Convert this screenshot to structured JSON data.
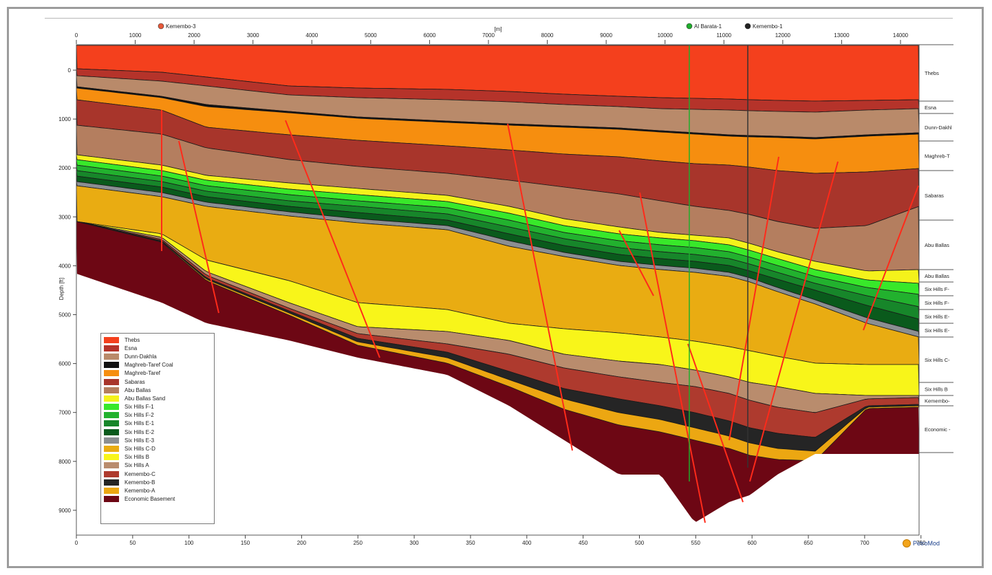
{
  "top_axis": {
    "unit": "[m]",
    "ticks": [
      "0",
      "1000",
      "2000",
      "3000",
      "4000",
      "5000",
      "6000",
      "7000",
      "8000",
      "9000",
      "10000",
      "11000",
      "12000",
      "13000",
      "14000"
    ]
  },
  "bottom_axis": {
    "ticks": [
      "0",
      "50",
      "100",
      "150",
      "200",
      "250",
      "300",
      "350",
      "400",
      "450",
      "500",
      "550",
      "600",
      "650",
      "700",
      "750"
    ]
  },
  "left_axis": {
    "label": "Depth [ft]",
    "ticks": [
      "0",
      "1000",
      "2000",
      "3000",
      "4000",
      "5000",
      "6000",
      "7000",
      "8000",
      "9000"
    ]
  },
  "wells": [
    {
      "name": "Kemembo-3",
      "color": "#e8593a"
    },
    {
      "name": "Al Barata-1",
      "color": "#1fae2c"
    },
    {
      "name": "Kemembo-1",
      "color": "#222222"
    }
  ],
  "right_labels": [
    "Thebs",
    "Esna",
    "Dunn-Dakhl",
    "Maghreb-T",
    "Sabaras",
    "Abu Ballas",
    "Abu Ballas",
    "Six Hills F-",
    "Six Hills F-",
    "Six Hills E-",
    "Six Hills E-",
    "Six Hills C-",
    "Six Hills B",
    "Kemembo-",
    "Economic -"
  ],
  "legend": [
    {
      "label": "Thebs",
      "color": "#f4401d"
    },
    {
      "label": "Esna",
      "color": "#b5332a"
    },
    {
      "label": "Dunn-Dakhla",
      "color": "#b98a6a"
    },
    {
      "label": "Maghreb-Taref Coal",
      "color": "#111111"
    },
    {
      "label": "Maghreb-Taref",
      "color": "#f68e0f"
    },
    {
      "label": "Sabaras",
      "color": "#a8352b"
    },
    {
      "label": "Abu Ballas",
      "color": "#b47e5f"
    },
    {
      "label": "Abu Ballas Sand",
      "color": "#f4f21b"
    },
    {
      "label": "Six Hills F-1",
      "color": "#38e82a"
    },
    {
      "label": "Six Hills F-2",
      "color": "#22b12e"
    },
    {
      "label": "Six Hills E-1",
      "color": "#17862a"
    },
    {
      "label": "Six Hills E-2",
      "color": "#0a5a1c"
    },
    {
      "label": "Six Hills E-3",
      "color": "#8b8f92"
    },
    {
      "label": "Six Hills C-D",
      "color": "#e9ac12"
    },
    {
      "label": "Six Hills B",
      "color": "#f8f51a"
    },
    {
      "label": "Six Hills A",
      "color": "#b98c6d"
    },
    {
      "label": "Kemembo-C",
      "color": "#ae3a2e"
    },
    {
      "label": "Kemembo-B",
      "color": "#252525"
    },
    {
      "label": "Kemembo-A",
      "color": "#eca712"
    },
    {
      "label": "Economic Basement",
      "color": "#6d0714"
    }
  ],
  "logo_text": "PetroMod",
  "fault_color": "#ff2a1a"
}
